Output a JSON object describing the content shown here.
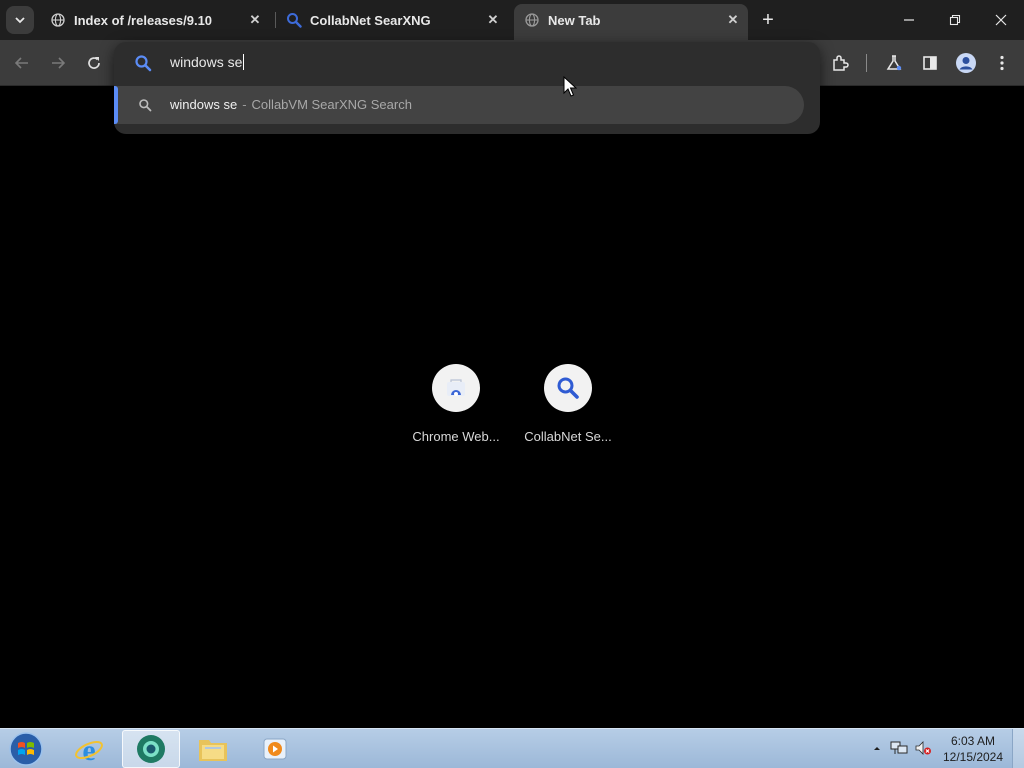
{
  "browser": {
    "tabs": [
      {
        "title": "Index of /releases/9.10",
        "favicon": "globe-icon",
        "active": false
      },
      {
        "title": "CollabNet SearXNG",
        "favicon": "search-icon",
        "active": false
      },
      {
        "title": "New Tab",
        "favicon": "globe-icon",
        "active": true
      }
    ],
    "new_tab_symbol": "+",
    "close_symbol": "✕"
  },
  "omnibox": {
    "query": "windows se",
    "suggestion": {
      "query": "windows se",
      "separator": "-",
      "engine": "CollabVM SearXNG Search"
    }
  },
  "shortcuts": [
    {
      "label": "Chrome Web...",
      "icon": "chrome-web-store-icon"
    },
    {
      "label": "CollabNet Se...",
      "icon": "search-icon"
    }
  ],
  "taskbar": {
    "apps": [
      "internet-explorer-icon",
      "chrome-icon",
      "file-explorer-icon",
      "media-player-icon"
    ],
    "clock": {
      "time": "6:03 AM",
      "date": "12/15/2024"
    }
  },
  "colors": {
    "accent": "#5b8cf6",
    "tab_bg": "#1f1f1f",
    "toolbar_bg": "#3c3c3c"
  }
}
